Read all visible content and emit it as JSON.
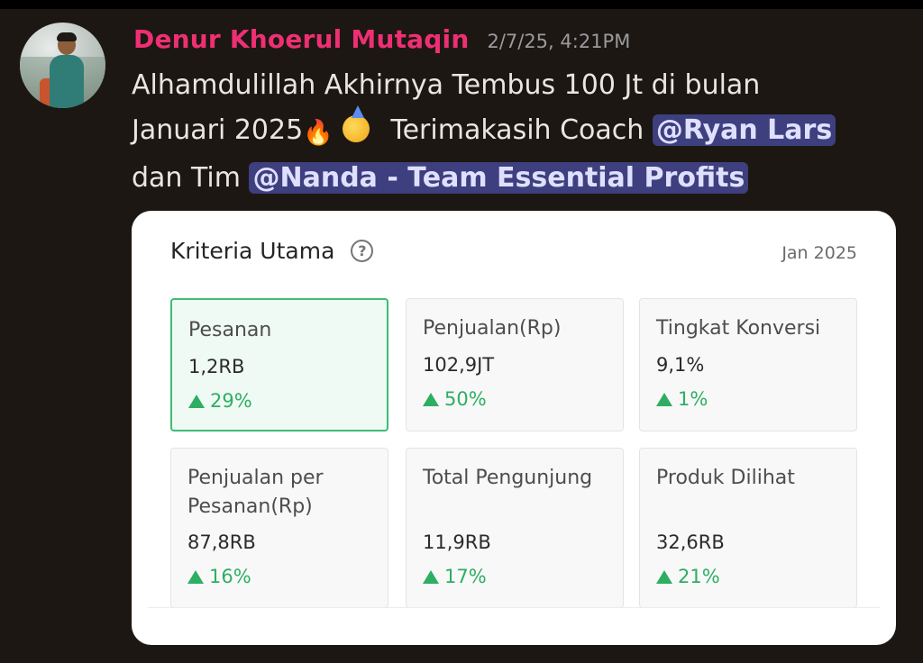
{
  "message": {
    "username": "Denur Khoerul Mutaqin",
    "timestamp": "2/7/25, 4:21PM",
    "text_line1": "Alhamdulillah Akhirnya Tembus 100 Jt di bulan",
    "text_line2_pre": "Januari 2025",
    "emoji_fire": "🔥",
    "text_line2_post": "Terimakasih Coach",
    "mention_1": "@Ryan Lars",
    "text_line3_mid": "dan Tim",
    "mention_2": "@Nanda - Team Essential Profits"
  },
  "card": {
    "title": "Kriteria Utama",
    "help_symbol": "?",
    "date": "Jan 2025",
    "metrics": [
      {
        "label": "Pesanan",
        "value": "1,2RB",
        "change": "29%"
      },
      {
        "label": "Penjualan(Rp)",
        "value": "102,9JT",
        "change": "50%"
      },
      {
        "label": "Tingkat Konversi",
        "value": "9,1%",
        "change": "1%"
      },
      {
        "label": "Penjualan per Pesanan(Rp)",
        "value": "87,8RB",
        "change": "16%"
      },
      {
        "label": "Total Pengunjung",
        "value": "11,9RB",
        "change": "17%"
      },
      {
        "label": "Produk Dilihat",
        "value": "32,6RB",
        "change": "21%"
      }
    ]
  },
  "colors": {
    "background": "#1c1712",
    "username": "#ee2f74",
    "mention_bg": "#3e3f7e",
    "increase_green": "#2eae63",
    "active_border": "#3dbd74"
  }
}
